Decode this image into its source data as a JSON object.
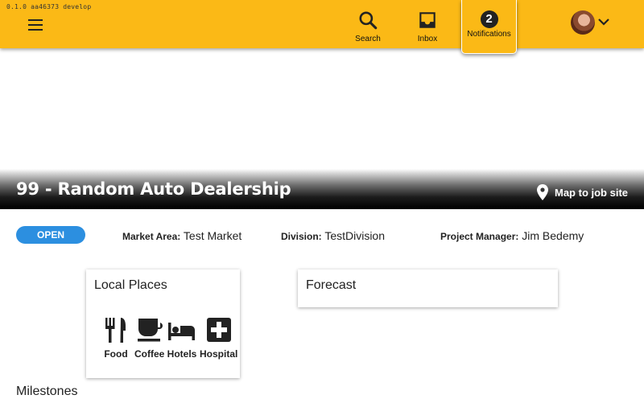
{
  "app": {
    "version": "0.1.0 aa46373 develop"
  },
  "appbar": {
    "search_label": "Search",
    "inbox_label": "Inbox",
    "notifications_label": "Notifications",
    "notifications_count": "2",
    "accent_color": "#fbb916"
  },
  "job": {
    "title": "99 - Random Auto Dealership",
    "map_link": "Map to job site",
    "status": "OPEN",
    "market_area_label": "Market Area:",
    "market_area": "Test Market",
    "division_label": "Division:",
    "division": "TestDivision",
    "pm_label": "Project Manager:",
    "pm": "Jim Bedemy"
  },
  "local_places": {
    "title": "Local Places",
    "items": [
      {
        "label": "Food",
        "icon": "food-icon"
      },
      {
        "label": "Coffee",
        "icon": "coffee-icon"
      },
      {
        "label": "Hotels",
        "icon": "hotel-icon"
      },
      {
        "label": "Hospital",
        "icon": "hospital-icon"
      }
    ]
  },
  "forecast": {
    "title": "Forecast"
  },
  "next_section": {
    "title": "Milestones"
  }
}
